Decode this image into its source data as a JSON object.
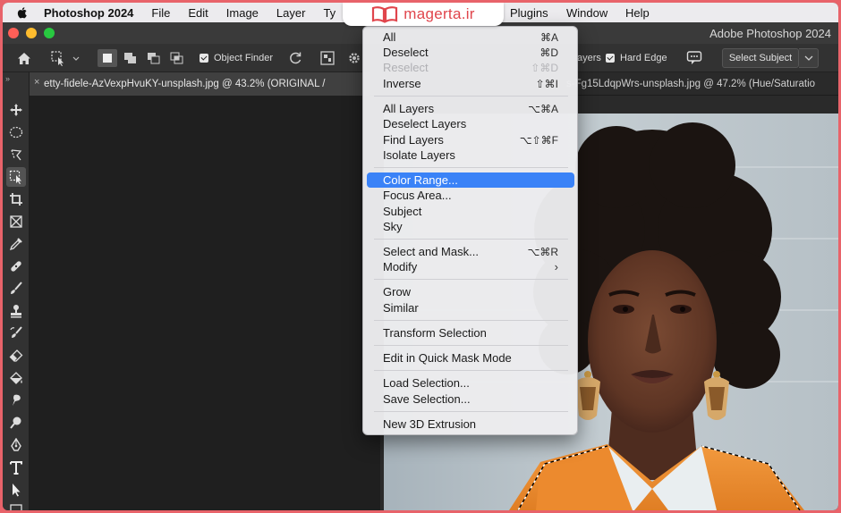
{
  "menubar": {
    "app_name": "Photoshop 2024",
    "items": [
      "File",
      "Edit",
      "Image",
      "Layer",
      "Ty",
      "Plugins",
      "Window",
      "Help"
    ]
  },
  "brand": {
    "text": "magerta.ir",
    "color": "#e0454c"
  },
  "window": {
    "title": "Adobe Photoshop 2024"
  },
  "options_bar": {
    "object_finder": "Object Finder",
    "layers_label": "ayers",
    "hard_edge": "Hard Edge",
    "select_subject": "Select Subject"
  },
  "tabs": {
    "active": "etty-fidele-AzVexpHvuKY-unsplash.jpg @ 43.2% (ORIGINAL /",
    "close_glyph": "×",
    "secondary": "s-Fg15LdqpWrs-unsplash.jpg @ 47.2% (Hue/Saturatio"
  },
  "toolbar": {
    "collapse_glyph": "»"
  },
  "select_menu": {
    "items": [
      {
        "label": "All",
        "shortcut": "⌘A"
      },
      {
        "label": "Deselect",
        "shortcut": "⌘D"
      },
      {
        "label": "Reselect",
        "shortcut": "⇧⌘D",
        "disabled": true
      },
      {
        "label": "Inverse",
        "shortcut": "⇧⌘I"
      },
      {
        "label": "All Layers",
        "shortcut": "⌥⌘A"
      },
      {
        "label": "Deselect Layers",
        "shortcut": ""
      },
      {
        "label": "Find Layers",
        "shortcut": "⌥⇧⌘F"
      },
      {
        "label": "Isolate Layers",
        "shortcut": ""
      },
      {
        "label": "Color Range...",
        "shortcut": "",
        "highlighted": true
      },
      {
        "label": "Focus Area...",
        "shortcut": ""
      },
      {
        "label": "Subject",
        "shortcut": ""
      },
      {
        "label": "Sky",
        "shortcut": ""
      },
      {
        "label": "Select and Mask...",
        "shortcut": "⌥⌘R"
      },
      {
        "label": "Modify",
        "shortcut": "",
        "submenu": true
      },
      {
        "label": "Grow",
        "shortcut": ""
      },
      {
        "label": "Similar",
        "shortcut": ""
      },
      {
        "label": "Transform Selection",
        "shortcut": ""
      },
      {
        "label": "Edit in Quick Mask Mode",
        "shortcut": ""
      },
      {
        "label": "Load Selection...",
        "shortcut": ""
      },
      {
        "label": "Save Selection...",
        "shortcut": ""
      },
      {
        "label": "New 3D Extrusion",
        "shortcut": ""
      }
    ],
    "submenu_glyph": "›"
  },
  "colors": {
    "frame_border": "#e8636a",
    "highlight": "#3a82f7",
    "ui_dark": "#2b2b2b"
  }
}
